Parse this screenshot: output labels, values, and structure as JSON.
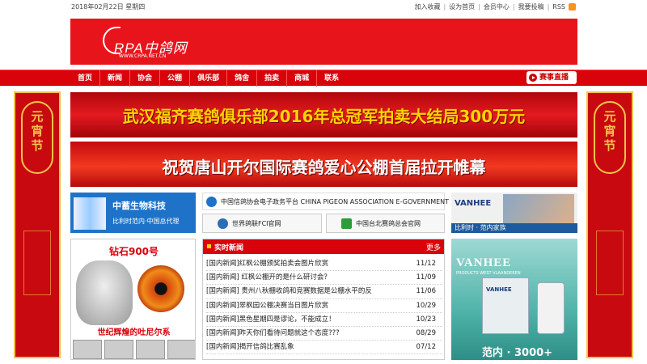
{
  "topbar": {
    "date": "2018年02月22日 星期四",
    "links": [
      "加入收藏",
      "设为首页",
      "会员中心",
      "我要投稿",
      "RSS"
    ]
  },
  "header": {
    "logo_text": "RPA中鸽网",
    "logo_url": "WWW.CRPA.NET.CN"
  },
  "nav": {
    "items": [
      "首页",
      "新闻",
      "协会",
      "公棚",
      "俱乐部",
      "鸽舍",
      "拍卖",
      "商城",
      "联系"
    ],
    "live_label": "赛事直播"
  },
  "side_banner": {
    "left_text": "元宵节",
    "right_text": "元宵节"
  },
  "promos": {
    "first": "武汉福齐赛鸽俱乐部2016年总冠军拍卖大结局300万元",
    "second": "祝贺唐山开尔国际赛鸽爱心公棚首届拉开帷幕"
  },
  "ads": {
    "bio_name": "中蓄生物科技",
    "bio_slogan": "比利时范内·中国总代理",
    "gov_platform": "中国信鸽协会电子政务平台 CHINA PIGEON ASSOCIATION E-GOVERNMENT PLATFORM",
    "fci_link": "世界鸽联FCI官网",
    "tw_link": "中国台北赛鸽总会官网",
    "vanhee_brand": "VANHEE",
    "vanhee_bar": "比利时 · 范内家族",
    "pigeon_title": "钻石900号",
    "pigeon_caption": "世纪辉煌的吐尼尔系",
    "vanhee_big_brand": "VANHEE",
    "vanhee_big_sub": "PRODUCTS WEST VLAANDEREN",
    "vanhee_box_name": "VANHEE",
    "vanhee_price": "范内 · 3000+"
  },
  "news": {
    "title": "实时新闻",
    "more": "更多",
    "items": [
      {
        "title": "[国内新闻]红枫公棚颁奖拍卖会图片欣赏",
        "date": "11/12"
      },
      {
        "title": "[国内新闻] 红枫公棚开的是什么研讨会？",
        "date": "11/09"
      },
      {
        "title": "[国内新闻] 贵州八秋棚收鸽和竞赛数据是公棚水平的反",
        "date": "11/06"
      },
      {
        "title": "[国内新闻]翠枫园公棚决赛当日图片欣赏",
        "date": "10/29"
      },
      {
        "title": "[国内新闻]黑色星期四是谬论，不能成立！",
        "date": "10/23"
      },
      {
        "title": "[国内新闻]昨天你们看待问题就这个态度???",
        "date": "08/29"
      },
      {
        "title": "[国内新闻]揭开信鸽比赛乱象",
        "date": "07/12"
      }
    ]
  },
  "colors": {
    "brand_red": "#d9040b",
    "banner_red": "#e8141c",
    "gold": "#ffd400"
  }
}
